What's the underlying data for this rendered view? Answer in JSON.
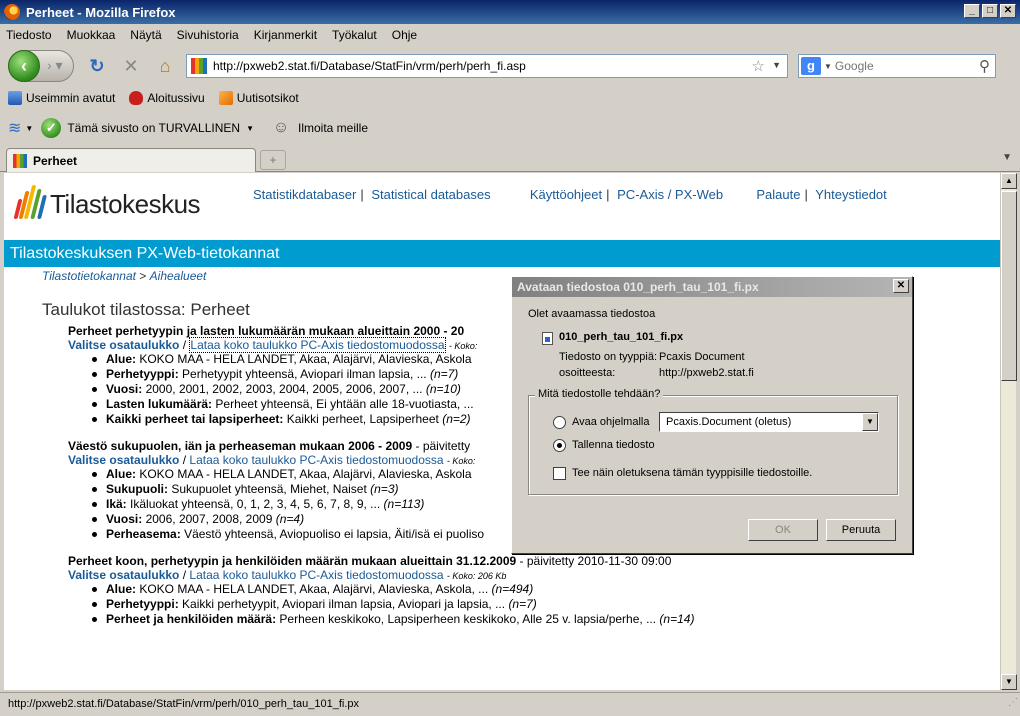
{
  "window": {
    "title": "Perheet - Mozilla Firefox"
  },
  "menu": [
    "Tiedosto",
    "Muokkaa",
    "Näytä",
    "Sivuhistoria",
    "Kirjanmerkit",
    "Työkalut",
    "Ohje"
  ],
  "nav": {
    "url": "http://pxweb2.stat.fi/Database/StatFin/vrm/perh/perh_fi.asp",
    "search_placeholder": "Google"
  },
  "bookmarks": [
    "Useimmin avatut",
    "Aloitussivu",
    "Uutisotsikot"
  ],
  "wot": {
    "status": "Tämä sivusto on TURVALLINEN",
    "report": "Ilmoita meille"
  },
  "tab": {
    "title": "Perheet"
  },
  "page": {
    "logo": "Tilastokeskus",
    "links": {
      "statistikdatabaser": "Statistikdatabaser",
      "statistical": "Statistical databases",
      "kayttoohjeet": "Käyttöohjeet",
      "pcaxis": "PC-Axis / PX-Web",
      "palaute": "Palaute",
      "yhteystiedot": "Yhteystiedot"
    },
    "banner": "Tilastokeskuksen PX-Web-tietokannat",
    "breadcrumb": {
      "first": "Tilastotietokannat",
      "sep": ">",
      "second": "Aihealueet"
    },
    "heading": "Taulukot tilastossa: Perheet",
    "select_label": "Valitse osataulukko",
    "download_label": "Lataa koko taulukko PC-Axis tiedostomuodossa",
    "tables": [
      {
        "title": "Perheet perhetyypin ja lasten lukumäärän mukaan alueittain 2000 - 20",
        "updated": "",
        "size": "- Koko:",
        "vars": [
          {
            "name": "Alue:",
            "values": "KOKO MAA - HELA LANDET, Akaa, Alajärvi, Alavieska, Askola",
            "count": ""
          },
          {
            "name": "Perhetyyppi:",
            "values": "Perhetyypit yhteensä, Aviopari ilman lapsia, ...",
            "count": "(n=7)"
          },
          {
            "name": "Vuosi:",
            "values": "2000, 2001, 2002, 2003, 2004, 2005, 2006, 2007, ...",
            "count": "(n=10)"
          },
          {
            "name": "Lasten lukumäärä:",
            "values": "Perheet yhteensä, Ei yhtään alle 18-vuotiasta, ...",
            "count": ""
          },
          {
            "name": "Kaikki perheet tai lapsiperheet:",
            "values": "Kaikki perheet, Lapsiperheet",
            "count": "(n=2)"
          }
        ]
      },
      {
        "title": "Väestö sukupuolen, iän ja perheaseman mukaan 2006 - 2009",
        "updated": "- päivitetty",
        "size": "- Koko:",
        "vars": [
          {
            "name": "Alue:",
            "values": "KOKO MAA - HELA LANDET, Akaa, Alajärvi, Alavieska, Askola",
            "count": ""
          },
          {
            "name": "Sukupuoli:",
            "values": "Sukupuolet yhteensä, Miehet, Naiset",
            "count": "(n=3)"
          },
          {
            "name": "Ikä:",
            "values": "Ikäluokat yhteensä, 0, 1, 2, 3, 4, 5, 6, 7, 8, 9, ...",
            "count": "(n=113)"
          },
          {
            "name": "Vuosi:",
            "values": "2006, 2007, 2008, 2009",
            "count": "(n=4)"
          },
          {
            "name": "Perheasema:",
            "values": "Väestö yhteensä, Aviopuoliso ei lapsia, Äiti/isä ei puoliso",
            "count": ""
          }
        ]
      },
      {
        "title": "Perheet koon, perhetyypin ja henkilöiden määrän mukaan alueittain 31.12.2009",
        "updated": "- päivitetty 2010-11-30 09:00",
        "size": "- Koko: 206 Kb",
        "vars": [
          {
            "name": "Alue:",
            "values": "KOKO MAA - HELA LANDET, Akaa, Alajärvi, Alavieska, Askola, ...",
            "count": "(n=494)"
          },
          {
            "name": "Perhetyyppi:",
            "values": "Kaikki perhetyypit, Aviopari ilman lapsia, Aviopari ja lapsia, ...",
            "count": "(n=7)"
          },
          {
            "name": "Perheet ja henkilöiden määrä:",
            "values": "Perheen keskikoko, Lapsiperheen keskikoko, Alle 25 v. lapsia/perhe, ...",
            "count": "(n=14)"
          }
        ]
      }
    ]
  },
  "status": "http://pxweb2.stat.fi/Database/StatFin/vrm/perh/010_perh_tau_101_fi.px",
  "dialog": {
    "title": "Avataan tiedostoa 010_perh_tau_101_fi.px",
    "intro": "Olet avaamassa tiedostoa",
    "filename": "010_perh_tau_101_fi.px",
    "type_label": "Tiedosto on tyyppiä:",
    "type_value": "Pcaxis Document",
    "from_label": "osoitteesta:",
    "from_value": "http://pxweb2.stat.fi",
    "group": "Mitä tiedostolle tehdään?",
    "open_with": "Avaa ohjelmalla",
    "app": "Pcaxis.Document (oletus)",
    "save": "Tallenna tiedosto",
    "default_check": "Tee näin oletuksena tämän tyyppisille tiedostoille.",
    "ok": "OK",
    "cancel": "Peruuta"
  }
}
